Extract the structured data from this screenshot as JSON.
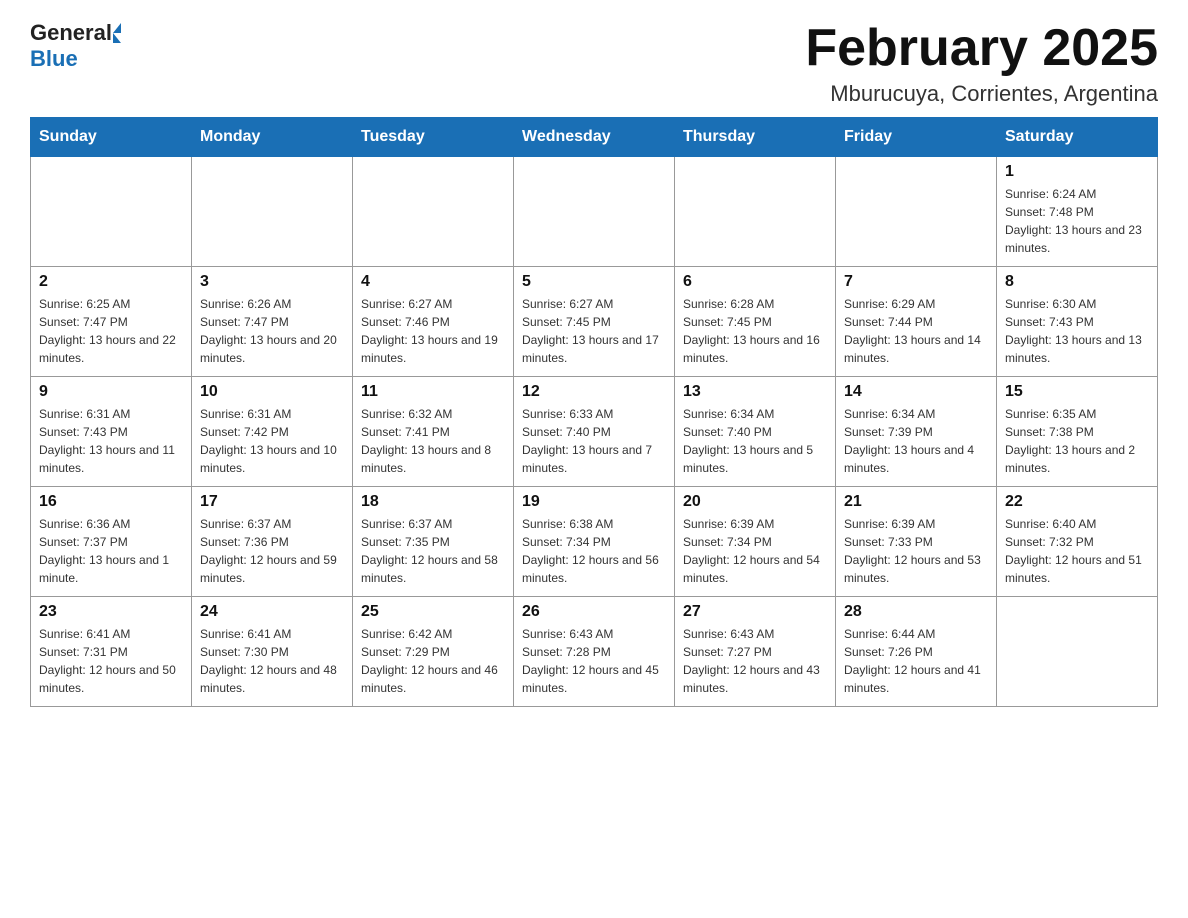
{
  "header": {
    "title": "February 2025",
    "subtitle": "Mburucuya, Corrientes, Argentina",
    "logo_general": "General",
    "logo_blue": "Blue"
  },
  "days_of_week": [
    "Sunday",
    "Monday",
    "Tuesday",
    "Wednesday",
    "Thursday",
    "Friday",
    "Saturday"
  ],
  "weeks": [
    [
      {
        "day": "",
        "info": ""
      },
      {
        "day": "",
        "info": ""
      },
      {
        "day": "",
        "info": ""
      },
      {
        "day": "",
        "info": ""
      },
      {
        "day": "",
        "info": ""
      },
      {
        "day": "",
        "info": ""
      },
      {
        "day": "1",
        "info": "Sunrise: 6:24 AM\nSunset: 7:48 PM\nDaylight: 13 hours and 23 minutes."
      }
    ],
    [
      {
        "day": "2",
        "info": "Sunrise: 6:25 AM\nSunset: 7:47 PM\nDaylight: 13 hours and 22 minutes."
      },
      {
        "day": "3",
        "info": "Sunrise: 6:26 AM\nSunset: 7:47 PM\nDaylight: 13 hours and 20 minutes."
      },
      {
        "day": "4",
        "info": "Sunrise: 6:27 AM\nSunset: 7:46 PM\nDaylight: 13 hours and 19 minutes."
      },
      {
        "day": "5",
        "info": "Sunrise: 6:27 AM\nSunset: 7:45 PM\nDaylight: 13 hours and 17 minutes."
      },
      {
        "day": "6",
        "info": "Sunrise: 6:28 AM\nSunset: 7:45 PM\nDaylight: 13 hours and 16 minutes."
      },
      {
        "day": "7",
        "info": "Sunrise: 6:29 AM\nSunset: 7:44 PM\nDaylight: 13 hours and 14 minutes."
      },
      {
        "day": "8",
        "info": "Sunrise: 6:30 AM\nSunset: 7:43 PM\nDaylight: 13 hours and 13 minutes."
      }
    ],
    [
      {
        "day": "9",
        "info": "Sunrise: 6:31 AM\nSunset: 7:43 PM\nDaylight: 13 hours and 11 minutes."
      },
      {
        "day": "10",
        "info": "Sunrise: 6:31 AM\nSunset: 7:42 PM\nDaylight: 13 hours and 10 minutes."
      },
      {
        "day": "11",
        "info": "Sunrise: 6:32 AM\nSunset: 7:41 PM\nDaylight: 13 hours and 8 minutes."
      },
      {
        "day": "12",
        "info": "Sunrise: 6:33 AM\nSunset: 7:40 PM\nDaylight: 13 hours and 7 minutes."
      },
      {
        "day": "13",
        "info": "Sunrise: 6:34 AM\nSunset: 7:40 PM\nDaylight: 13 hours and 5 minutes."
      },
      {
        "day": "14",
        "info": "Sunrise: 6:34 AM\nSunset: 7:39 PM\nDaylight: 13 hours and 4 minutes."
      },
      {
        "day": "15",
        "info": "Sunrise: 6:35 AM\nSunset: 7:38 PM\nDaylight: 13 hours and 2 minutes."
      }
    ],
    [
      {
        "day": "16",
        "info": "Sunrise: 6:36 AM\nSunset: 7:37 PM\nDaylight: 13 hours and 1 minute."
      },
      {
        "day": "17",
        "info": "Sunrise: 6:37 AM\nSunset: 7:36 PM\nDaylight: 12 hours and 59 minutes."
      },
      {
        "day": "18",
        "info": "Sunrise: 6:37 AM\nSunset: 7:35 PM\nDaylight: 12 hours and 58 minutes."
      },
      {
        "day": "19",
        "info": "Sunrise: 6:38 AM\nSunset: 7:34 PM\nDaylight: 12 hours and 56 minutes."
      },
      {
        "day": "20",
        "info": "Sunrise: 6:39 AM\nSunset: 7:34 PM\nDaylight: 12 hours and 54 minutes."
      },
      {
        "day": "21",
        "info": "Sunrise: 6:39 AM\nSunset: 7:33 PM\nDaylight: 12 hours and 53 minutes."
      },
      {
        "day": "22",
        "info": "Sunrise: 6:40 AM\nSunset: 7:32 PM\nDaylight: 12 hours and 51 minutes."
      }
    ],
    [
      {
        "day": "23",
        "info": "Sunrise: 6:41 AM\nSunset: 7:31 PM\nDaylight: 12 hours and 50 minutes."
      },
      {
        "day": "24",
        "info": "Sunrise: 6:41 AM\nSunset: 7:30 PM\nDaylight: 12 hours and 48 minutes."
      },
      {
        "day": "25",
        "info": "Sunrise: 6:42 AM\nSunset: 7:29 PM\nDaylight: 12 hours and 46 minutes."
      },
      {
        "day": "26",
        "info": "Sunrise: 6:43 AM\nSunset: 7:28 PM\nDaylight: 12 hours and 45 minutes."
      },
      {
        "day": "27",
        "info": "Sunrise: 6:43 AM\nSunset: 7:27 PM\nDaylight: 12 hours and 43 minutes."
      },
      {
        "day": "28",
        "info": "Sunrise: 6:44 AM\nSunset: 7:26 PM\nDaylight: 12 hours and 41 minutes."
      },
      {
        "day": "",
        "info": ""
      }
    ]
  ],
  "accent_color": "#1a6fb5"
}
